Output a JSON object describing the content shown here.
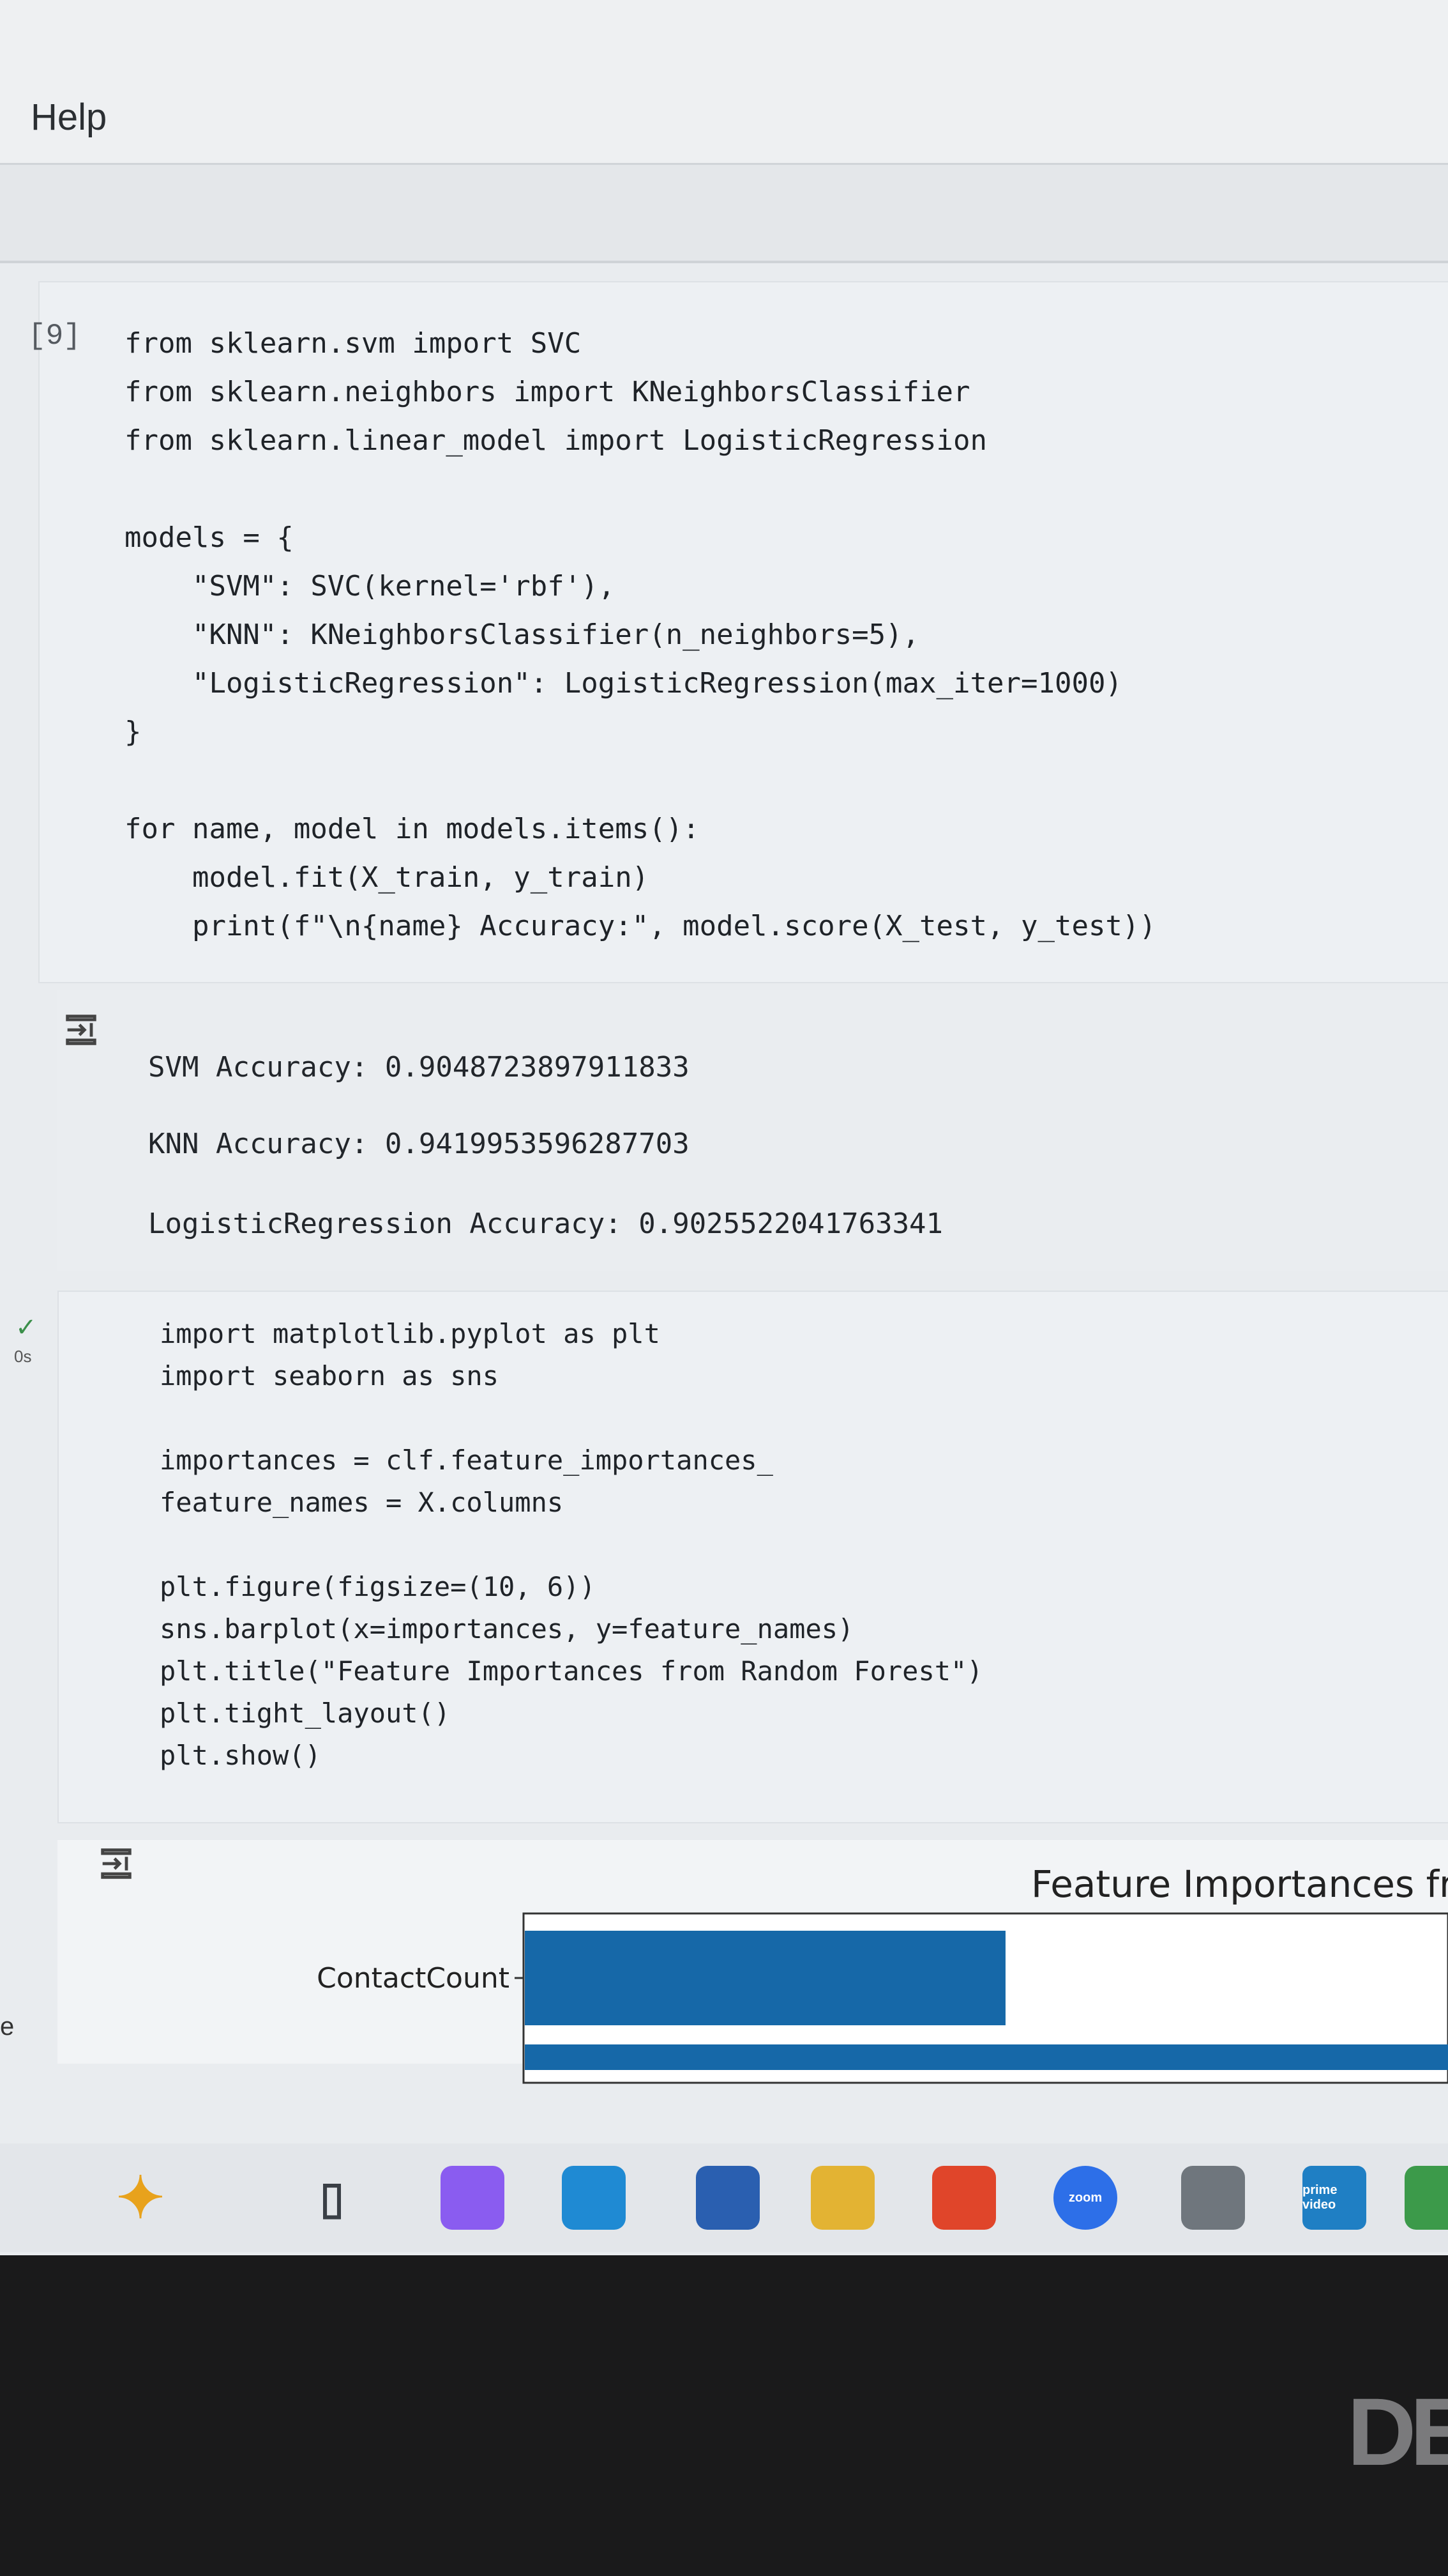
{
  "menu": {
    "help_label": "Help"
  },
  "cell1": {
    "exec_count": "[9]",
    "lines": [
      "from sklearn.svm import SVC",
      "from sklearn.neighbors import KNeighborsClassifier",
      "from sklearn.linear_model import LogisticRegression",
      "",
      "models = {",
      "    \"SVM\": SVC(kernel='rbf'),",
      "    \"KNN\": KNeighborsClassifier(n_neighbors=5),",
      "    \"LogisticRegression\": LogisticRegression(max_iter=1000)",
      "}",
      "",
      "for name, model in models.items():",
      "    model.fit(X_train, y_train)",
      "    print(f\"\\n{name} Accuracy:\", model.score(X_test, y_test))"
    ]
  },
  "output1": {
    "lines": [
      "SVM Accuracy: 0.9048723897911833",
      "KNN Accuracy: 0.9419953596287703",
      "LogisticRegression Accuracy: 0.9025522041763341"
    ]
  },
  "cell2": {
    "status_check": "✓",
    "exec_time": "0s",
    "lines": [
      "import matplotlib.pyplot as plt",
      "import seaborn as sns",
      "",
      "importances = clf.feature_importances_",
      "feature_names = X.columns",
      "",
      "plt.figure(figsize=(10, 6))",
      "sns.barplot(x=importances, y=feature_names)",
      "plt.title(\"Feature Importances from Random Forest\")",
      "plt.tight_layout()",
      "plt.show()"
    ]
  },
  "output2": {
    "chart_title_visible": "Feature Importances fr",
    "bar_color": "#1668a8"
  },
  "chart_data": {
    "type": "bar",
    "title": "Feature Importances fr",
    "categories": [
      "ContactCount",
      ""
    ],
    "values": [
      0.52,
      1.0
    ],
    "orientation": "horizontal"
  },
  "left_edge_char": "e",
  "taskbar": {
    "icons": [
      {
        "name": "copilot-sparkle-icon",
        "label": "",
        "color": "#e8a21c"
      },
      {
        "name": "task-view-icon",
        "label": "",
        "color": "#3a3f46"
      },
      {
        "name": "copilot-app-icon",
        "label": "",
        "color": "#8a5cf0"
      },
      {
        "name": "edge-icon",
        "label": "",
        "color": "#1f8ad3"
      },
      {
        "name": "store-icon",
        "label": "",
        "color": "#2a5fb0"
      },
      {
        "name": "file-explorer-icon",
        "label": "",
        "color": "#e3b333"
      },
      {
        "name": "brave-icon",
        "label": "",
        "color": "#e0452a"
      },
      {
        "name": "zoom-icon",
        "label": "zoom",
        "color": "#2d6fe8"
      },
      {
        "name": "app-icon",
        "label": "",
        "color": "#6f767d"
      },
      {
        "name": "prime-video-icon",
        "label": "prime video",
        "color": "#1f7fc4"
      },
      {
        "name": "chrome-icon",
        "label": "",
        "color": "#3c9a4a"
      }
    ]
  },
  "bezel": {
    "brand": "DE"
  }
}
